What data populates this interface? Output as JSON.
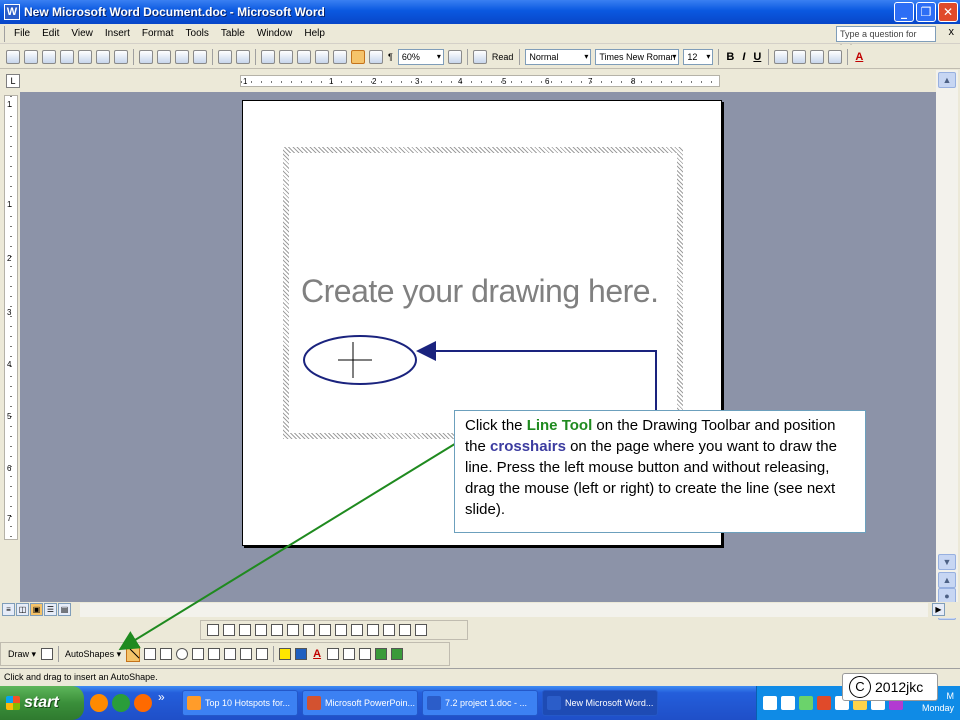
{
  "window": {
    "title": "New Microsoft Word Document.doc - Microsoft Word",
    "app_icon_label": "W",
    "minimize": "_",
    "restore": "❐",
    "close": "✕"
  },
  "menubar": {
    "items": [
      "File",
      "Edit",
      "View",
      "Insert",
      "Format",
      "Tools",
      "Table",
      "Window",
      "Help"
    ],
    "help_placeholder": "Type a question for help",
    "close": "x"
  },
  "toolbar": {
    "zoom": "60%",
    "read_label": "Read",
    "style": "Normal",
    "font": "Times New Roman",
    "size": "12",
    "bold": "B",
    "italic": "I",
    "underline": "U",
    "font_color_label": "A",
    "pilcrow": "¶"
  },
  "ruler": {
    "corner": "L",
    "h_numbers": [
      "1",
      "1",
      "2",
      "3",
      "4",
      "5",
      "6",
      "7",
      "8"
    ],
    "v_numbers": [
      "1",
      "1",
      "2",
      "3",
      "4",
      "5",
      "6",
      "7"
    ]
  },
  "document": {
    "canvas_text": "Create your drawing here."
  },
  "drawing_toolbar": {
    "draw_label": "Draw ▾",
    "autoshapes_label": "AutoShapes ▾",
    "font_color_label": "A"
  },
  "status": {
    "text": "Click and drag to insert an AutoShape."
  },
  "taskbar": {
    "start_label": "start",
    "chevron": "»",
    "tasks": [
      {
        "label": "Top 10 Hotspots for..."
      },
      {
        "label": "Microsoft PowerPoin..."
      },
      {
        "label": "7.2 project 1.doc - ..."
      },
      {
        "label": "New Microsoft Word..."
      }
    ],
    "clock_time": "M",
    "clock_day": "Monday"
  },
  "callout": {
    "part1": "Click the ",
    "line_tool": "Line Tool",
    "part2": " on the Drawing Toolbar and position the ",
    "crosshairs": "crosshairs",
    "part3": " on the page where you want to draw the line. Press the left mouse button and without releasing, drag the mouse (left or right) to create the line (see next slide)."
  },
  "copyright": {
    "symbol": "C",
    "text": "2012jkc"
  },
  "colors": {
    "green_arrow": "#1f8a1f",
    "navy_annotation": "#1a237e"
  }
}
